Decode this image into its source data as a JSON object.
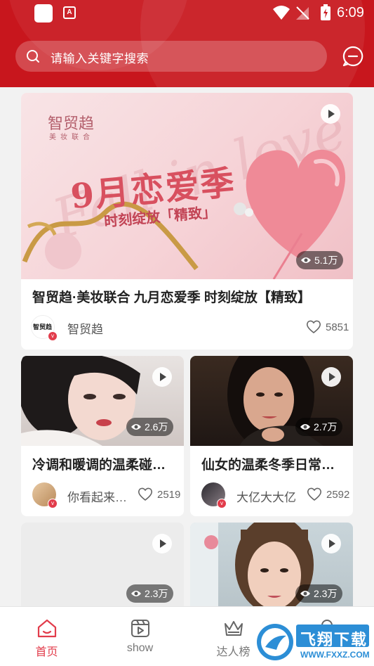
{
  "status_bar": {
    "time": "6:09",
    "app_icon_letter": "A"
  },
  "search": {
    "placeholder": "请输入关键字搜索"
  },
  "colors": {
    "brand": "#c8161d",
    "accent": "#e23c4b"
  },
  "feed": [
    {
      "banner_brand": "智贸趋",
      "banner_brand_sub": "美妆联合",
      "banner_headline": "9月恋爱季",
      "banner_tagline": "时刻绽放「精致」",
      "views": "5.1万",
      "title": "智贸趋·美妆联合 九月恋爱季 时刻绽放【精致】",
      "author": "智贸趋",
      "author_avatar_text": "智贸趋",
      "likes": "5851"
    },
    {
      "views": "2.6万",
      "title": "冷调和暖调的温柔碰…",
      "author": "你看起来…",
      "likes": "2519"
    },
    {
      "views": "2.7万",
      "title": "仙女的温柔冬季日常…",
      "author": "大亿大大亿",
      "likes": "2592"
    },
    {
      "views": "2.3万"
    },
    {
      "views": "2.3万"
    }
  ],
  "tabs": [
    {
      "label": "首页",
      "icon": "home-icon",
      "active": true
    },
    {
      "label": "show",
      "icon": "video-icon",
      "active": false
    },
    {
      "label": "达人榜",
      "icon": "crown-icon",
      "active": false
    },
    {
      "label": "",
      "icon": "user-icon",
      "active": false
    }
  ],
  "watermark": {
    "text": "飞翔下载",
    "url": "WWW.FXXZ.COM"
  }
}
